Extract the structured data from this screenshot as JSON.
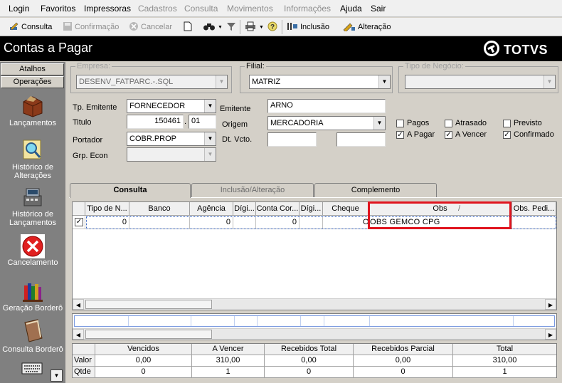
{
  "menu": {
    "items": [
      {
        "label": "Login",
        "enabled": true
      },
      {
        "label": "Favoritos",
        "enabled": true
      },
      {
        "label": "Impressoras",
        "enabled": true
      },
      {
        "label": "Cadastros",
        "enabled": false
      },
      {
        "label": "Consulta",
        "enabled": false
      },
      {
        "label": "Movimentos",
        "enabled": false
      },
      {
        "label": "Informações",
        "enabled": false
      },
      {
        "label": "Ajuda",
        "enabled": true
      },
      {
        "label": "Sair",
        "enabled": true
      }
    ]
  },
  "toolbar": {
    "consulta": "Consulta",
    "confirmacao": "Confirmação",
    "cancelar": "Cancelar",
    "inclusao": "Inclusão",
    "alteracao": "Alteração"
  },
  "header": {
    "title": "Contas a Pagar",
    "brand": "TOTVS"
  },
  "sidebar": {
    "tabs": [
      "Atalhos",
      "Operações"
    ],
    "items": [
      {
        "label": "Lançamentos",
        "icon": "box-icon"
      },
      {
        "label": "Histórico de Alterações",
        "icon": "magnifier-icon"
      },
      {
        "label": "Histórico de Lançamentos",
        "icon": "register-icon"
      },
      {
        "label": "Cancelamento",
        "icon": "cancel-icon"
      },
      {
        "label": "Geração Borderô",
        "icon": "books-icon"
      },
      {
        "label": "Consulta Borderô",
        "icon": "ledger-icon"
      }
    ]
  },
  "filters": {
    "empresa_label": "Empresa:",
    "empresa_value": "DESENV_FATPARC.-.SQL",
    "filial_label": "Filial:",
    "filial_value": "MATRIZ",
    "tipo_negocio_label": "Tipo de Negócio:",
    "tipo_negocio_value": ""
  },
  "form": {
    "tp_emitente_label": "Tp. Emitente",
    "tp_emitente_value": "FORNECEDOR",
    "titulo_label": "Titulo",
    "titulo_value": "150461",
    "titulo_sep": ".",
    "titulo_parcela": "01",
    "portador_label": "Portador",
    "portador_value": "COBR.PROP",
    "grp_econ_label": "Grp. Econ",
    "grp_econ_value": "",
    "emitente_label": "Emitente",
    "emitente_value": "ARNO",
    "origem_label": "Origem",
    "origem_value": "MERCADORIA",
    "dt_vcto_label": "Dt. Vcto.",
    "dt_vcto_from": "",
    "dt_vcto_to": ""
  },
  "checkboxes": [
    {
      "label": "Pagos",
      "checked": false
    },
    {
      "label": "Atrasado",
      "checked": false
    },
    {
      "label": "Previsto",
      "checked": false
    },
    {
      "label": "A Pagar",
      "checked": true
    },
    {
      "label": "A Vencer",
      "checked": true
    },
    {
      "label": "Confirmado",
      "checked": true
    }
  ],
  "tabs": [
    "Consulta",
    "Inclusão/Alteração",
    "Complemento"
  ],
  "grid": {
    "columns": [
      "Tipo de N...",
      "Banco",
      "Agência",
      "Dígi...",
      "Conta Cor...",
      "Dígi...",
      "Cheque",
      "Obs",
      "Obs. Pedi..."
    ],
    "sort_indicator": "/",
    "row": {
      "checked": true,
      "tipo": "0",
      "banco": "",
      "agencia": "0",
      "digito1": "",
      "conta": "0",
      "digito2": "",
      "cheque": "",
      "obs_prefix": "O",
      "obs": "OBS GEMCO CPG",
      "obs_pedido": ""
    }
  },
  "totals": {
    "columns": [
      "Vencidos",
      "A Vencer",
      "Recebidos Total",
      "Recebidos Parcial",
      "Total"
    ],
    "rows": [
      {
        "label": "Valor",
        "values": [
          "0,00",
          "310,00",
          "0,00",
          "0,00",
          "310,00"
        ]
      },
      {
        "label": "Qtde",
        "values": [
          "0",
          "1",
          "0",
          "0",
          "1"
        ]
      }
    ]
  },
  "colors": {
    "highlight": "#e0141e",
    "title_bg": "#000000",
    "sidebar_bg": "#808080"
  }
}
